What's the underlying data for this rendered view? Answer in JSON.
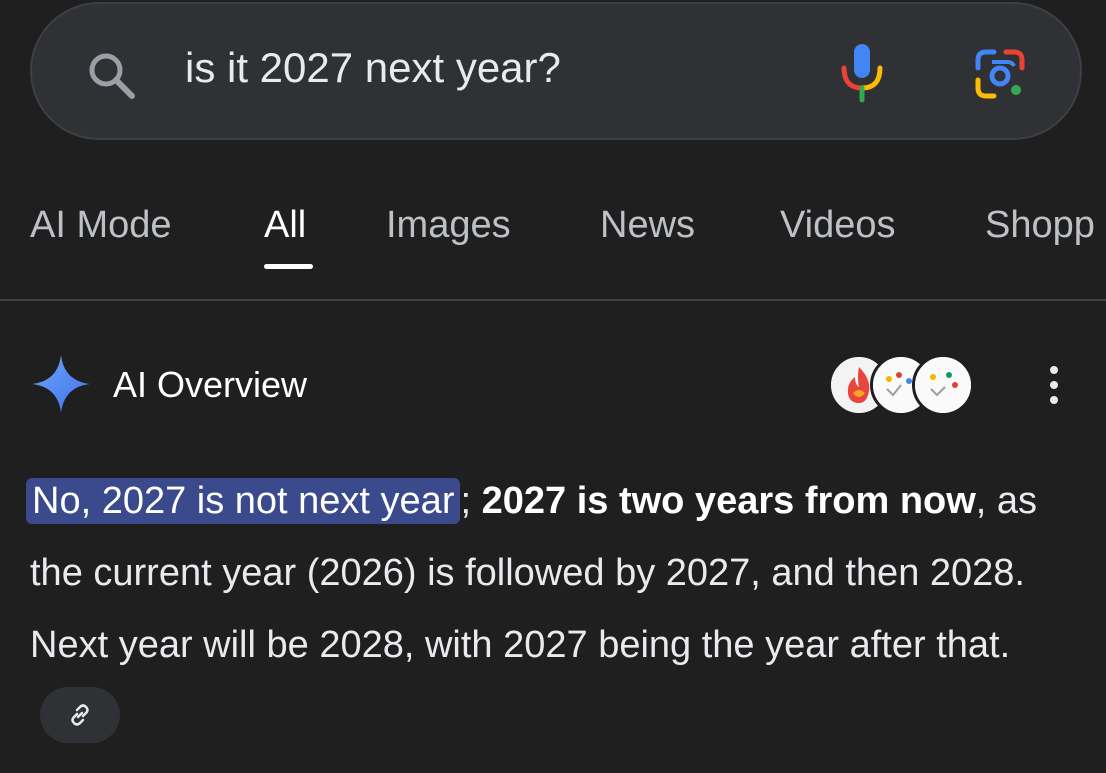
{
  "search": {
    "query": "is it 2027 next year?"
  },
  "icons": {
    "search": "search-icon",
    "mic": "mic-icon",
    "lens": "lens-icon",
    "sparkle": "sparkle-icon",
    "more": "more-vert-icon",
    "link": "link-icon"
  },
  "tabs": [
    {
      "label": "AI Mode",
      "active": false
    },
    {
      "label": "All",
      "active": true
    },
    {
      "label": "Images",
      "active": false
    },
    {
      "label": "News",
      "active": false
    },
    {
      "label": "Videos",
      "active": false
    },
    {
      "label": "Shopp",
      "active": false
    }
  ],
  "overview": {
    "title": "AI Overview",
    "answer": {
      "highlighted": "No, 2027 is not next year",
      "sep": "; ",
      "bold": "2027 is two years from now",
      "rest": ", as the current year (2026) is followed by 2027, and then 2028. Next year will be 2028, with 2027 being the year after that."
    }
  },
  "colors": {
    "background": "#1f1f1f",
    "search_bg": "#303134",
    "highlight": "#3b4a8c",
    "sparkle": "#4a7dff"
  }
}
